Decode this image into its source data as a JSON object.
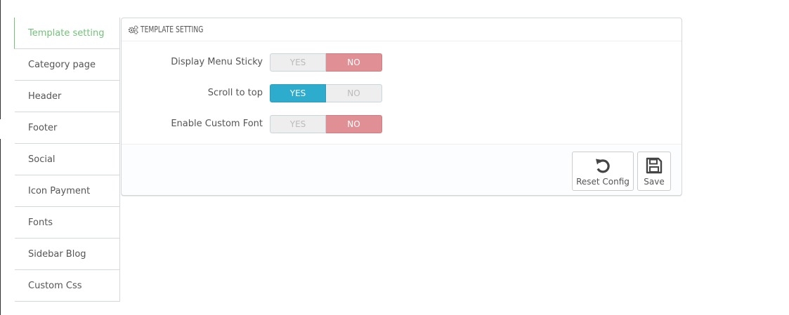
{
  "sidebar": {
    "items": [
      {
        "label": "Template setting",
        "active": true
      },
      {
        "label": "Category page"
      },
      {
        "label": "Header"
      },
      {
        "label": "Footer"
      },
      {
        "label": "Social"
      },
      {
        "label": "Icon Payment"
      },
      {
        "label": "Fonts"
      },
      {
        "label": "Sidebar Blog"
      },
      {
        "label": "Custom Css"
      }
    ]
  },
  "panel": {
    "title": "TEMPLATE SETTING",
    "title_icon": "cogs-icon",
    "fields": [
      {
        "label": "Display Menu Sticky",
        "yes_label": "YES",
        "no_label": "NO",
        "value": "NO"
      },
      {
        "label": "Scroll to top",
        "yes_label": "YES",
        "no_label": "NO",
        "value": "YES"
      },
      {
        "label": "Enable Custom Font",
        "yes_label": "YES",
        "no_label": "NO",
        "value": "NO"
      }
    ],
    "footer": {
      "reset_label": "Reset Config",
      "reset_icon": "undo-icon",
      "save_label": "Save",
      "save_icon": "floppy-disk-icon"
    }
  },
  "colors": {
    "active_tab": "#72c279",
    "switch_yes_on": "#2eacce",
    "switch_no_on": "#e08f95"
  }
}
